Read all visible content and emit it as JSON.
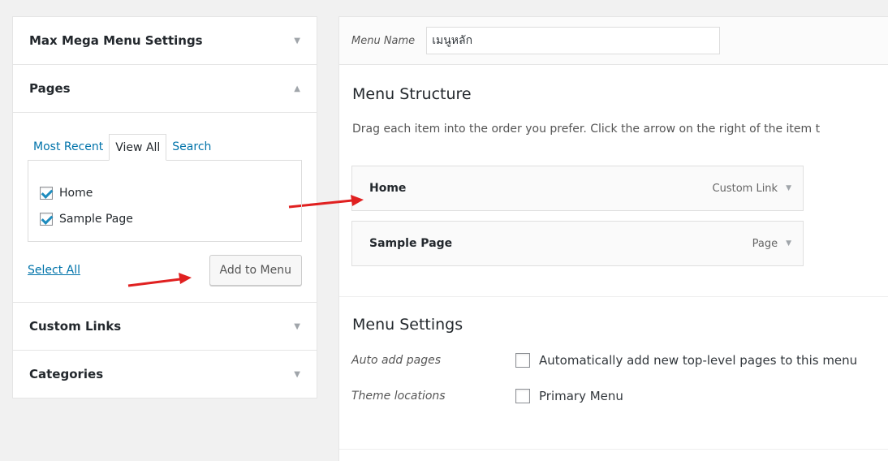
{
  "left": {
    "sections": {
      "megamenu": {
        "title": "Max Mega Menu Settings"
      },
      "pages": {
        "title": "Pages",
        "tabs": [
          "Most Recent",
          "View All",
          "Search"
        ],
        "items": [
          {
            "label": "Home",
            "checked": true
          },
          {
            "label": "Sample Page",
            "checked": true
          }
        ],
        "select_all": "Select All",
        "add_button": "Add to Menu"
      },
      "custom_links": {
        "title": "Custom Links"
      },
      "categories": {
        "title": "Categories"
      }
    }
  },
  "right": {
    "menu_name_label": "Menu Name",
    "menu_name_value": "เมนูหลัก",
    "structure_title": "Menu Structure",
    "structure_desc": "Drag each item into the order you prefer. Click the arrow on the right of the item t",
    "items": [
      {
        "title": "Home",
        "type": "Custom Link"
      },
      {
        "title": "Sample Page",
        "type": "Page"
      }
    ],
    "settings_title": "Menu Settings",
    "auto_add_label": "Auto add pages",
    "auto_add_text": "Automatically add new top-level pages to this menu",
    "theme_locations_label": "Theme locations",
    "theme_location_option": "Primary Menu"
  },
  "colors": {
    "annotation_arrow": "#e02020",
    "link": "#0073aa",
    "check": "#1e8cbe"
  }
}
